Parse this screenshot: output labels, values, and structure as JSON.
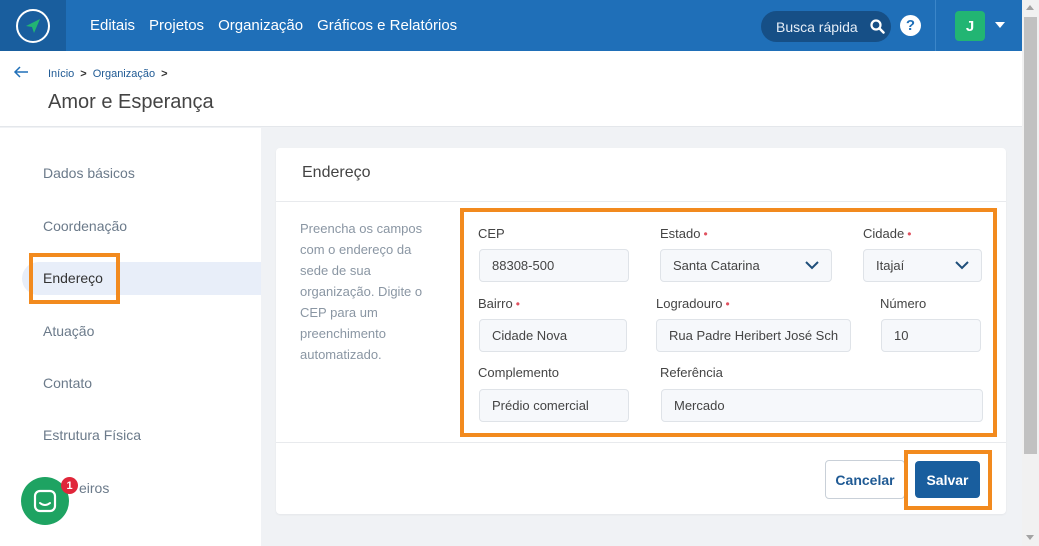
{
  "nav": {
    "items": [
      "Editais",
      "Projetos",
      "Organização",
      "Gráficos e Relatórios"
    ],
    "search_placeholder": "Busca rápida",
    "help_label": "?",
    "avatar_initial": "J"
  },
  "breadcrumb": {
    "items": [
      "Início",
      "Organização"
    ],
    "separator": ">"
  },
  "page_title": "Amor e Esperança",
  "sidebar": {
    "items": [
      "Dados básicos",
      "Coordenação",
      "Endereço",
      "Atuação",
      "Contato",
      "Estrutura Física",
      "eiros"
    ],
    "active": "Endereço"
  },
  "card": {
    "title": "Endereço",
    "description": "Preencha os campos com o endereço da sede de sua organização. Digite o CEP para um preenchimento automatizado."
  },
  "form": {
    "cep": {
      "label": "CEP",
      "value": "88308-500"
    },
    "estado": {
      "label": "Estado",
      "value": "Santa Catarina",
      "required": "•"
    },
    "cidade": {
      "label": "Cidade",
      "value": "Itajaí",
      "required": "•"
    },
    "bairro": {
      "label": "Bairro",
      "value": "Cidade Nova",
      "required": "•"
    },
    "logradouro": {
      "label": "Logradouro",
      "value": "Rua Padre Heribert José Sch",
      "required": "•"
    },
    "numero": {
      "label": "Número",
      "value": "10"
    },
    "complemento": {
      "label": "Complemento",
      "value": "Prédio comercial"
    },
    "referencia": {
      "label": "Referência",
      "value": "Mercado"
    }
  },
  "actions": {
    "cancel": "Cancelar",
    "save": "Salvar"
  },
  "chat": {
    "badge": "1"
  },
  "colors": {
    "primary": "#1f6fb8",
    "highlight": "#f28a1e",
    "required": "#e05260",
    "avatar": "#22b573"
  }
}
